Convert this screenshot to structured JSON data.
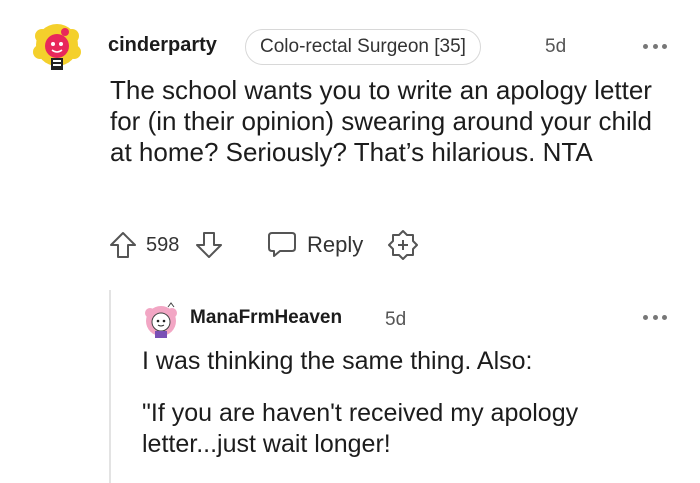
{
  "comment": {
    "username": "cinderparty",
    "flair": "Colo-rectal Surgeon [35]",
    "time": "5d",
    "body": "The school wants you to write an apology letter for (in their opinion) swearing around your child at home? Seriously? That’s hilarious. NTA",
    "votes": "598",
    "reply_label": "Reply"
  },
  "reply": {
    "username": "ManaFrmHeaven",
    "time": "5d",
    "line1": "I was thinking the same thing. Also:",
    "line2": "\"If you are haven't received my apology letter...just wait longer!"
  },
  "colors": {
    "avatar1_hair": "#f4d02c",
    "avatar1_face": "#e8285b",
    "avatar2_hair": "#f2a6c4",
    "text": "#1c1c1c",
    "muted": "#555555"
  },
  "icons": [
    "upvote-icon",
    "downvote-icon",
    "reply-icon",
    "award-icon",
    "more-options-icon"
  ]
}
